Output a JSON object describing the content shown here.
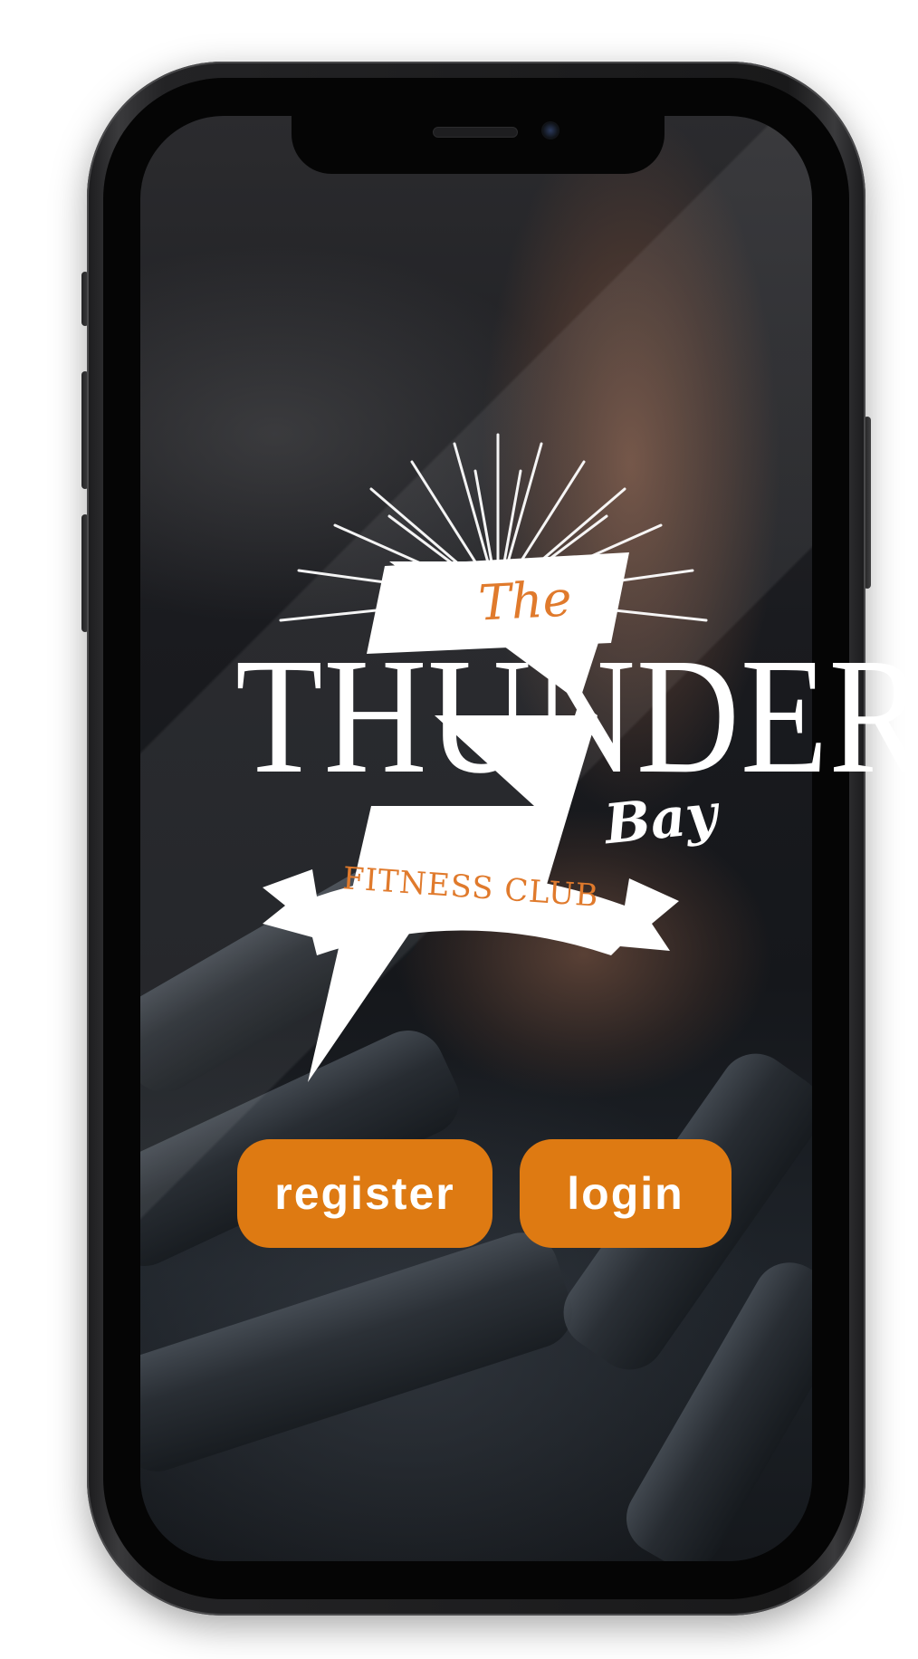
{
  "app": {
    "brand_color": "#de7a12",
    "accent_color": "#e07a2c"
  },
  "logo": {
    "the": "The",
    "thunder": "THUNDER",
    "bay": "Bay",
    "fitness_club": "FITNESS CLUB"
  },
  "actions": {
    "register_label": "register",
    "login_label": "login"
  }
}
